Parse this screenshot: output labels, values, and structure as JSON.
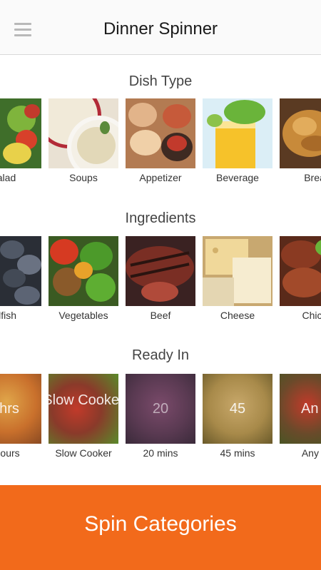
{
  "header": {
    "title": "Dinner Spinner",
    "menu_icon": "hamburger-menu-icon"
  },
  "sections": {
    "dish_type": {
      "title": "Dish Type",
      "items": [
        {
          "label": "alad",
          "image": "salad-photo"
        },
        {
          "label": "Soups",
          "image": "soup-photo"
        },
        {
          "label": "Appetizer",
          "image": "appetizer-photo"
        },
        {
          "label": "Beverage",
          "image": "beverage-photo"
        },
        {
          "label": "Brea",
          "image": "bread-photo"
        }
      ]
    },
    "ingredients": {
      "title": "Ingredients",
      "items": [
        {
          "label": "llfish",
          "image": "shellfish-photo"
        },
        {
          "label": "Vegetables",
          "image": "vegetables-photo"
        },
        {
          "label": "Beef",
          "image": "beef-photo"
        },
        {
          "label": "Cheese",
          "image": "cheese-photo"
        },
        {
          "label": "Chick",
          "image": "chicken-photo"
        }
      ]
    },
    "ready_in": {
      "title": "Ready In",
      "items": [
        {
          "label": "Hours",
          "overlay": "hrs",
          "image": "blurred-food-photo"
        },
        {
          "label": "Slow Cooker",
          "overlay": "Slow Cooker",
          "image": "blurred-food-photo"
        },
        {
          "label": "20 mins",
          "overlay": "20",
          "image": "blurred-food-photo"
        },
        {
          "label": "45 mins",
          "overlay": "45",
          "image": "blurred-food-photo"
        },
        {
          "label": "Any T",
          "overlay": "An",
          "image": "blurred-food-photo"
        }
      ]
    }
  },
  "footer": {
    "spin_label": "Spin Categories"
  },
  "colors": {
    "accent": "#f26a1b",
    "header_bg": "#fafafa",
    "text": "#333333"
  }
}
